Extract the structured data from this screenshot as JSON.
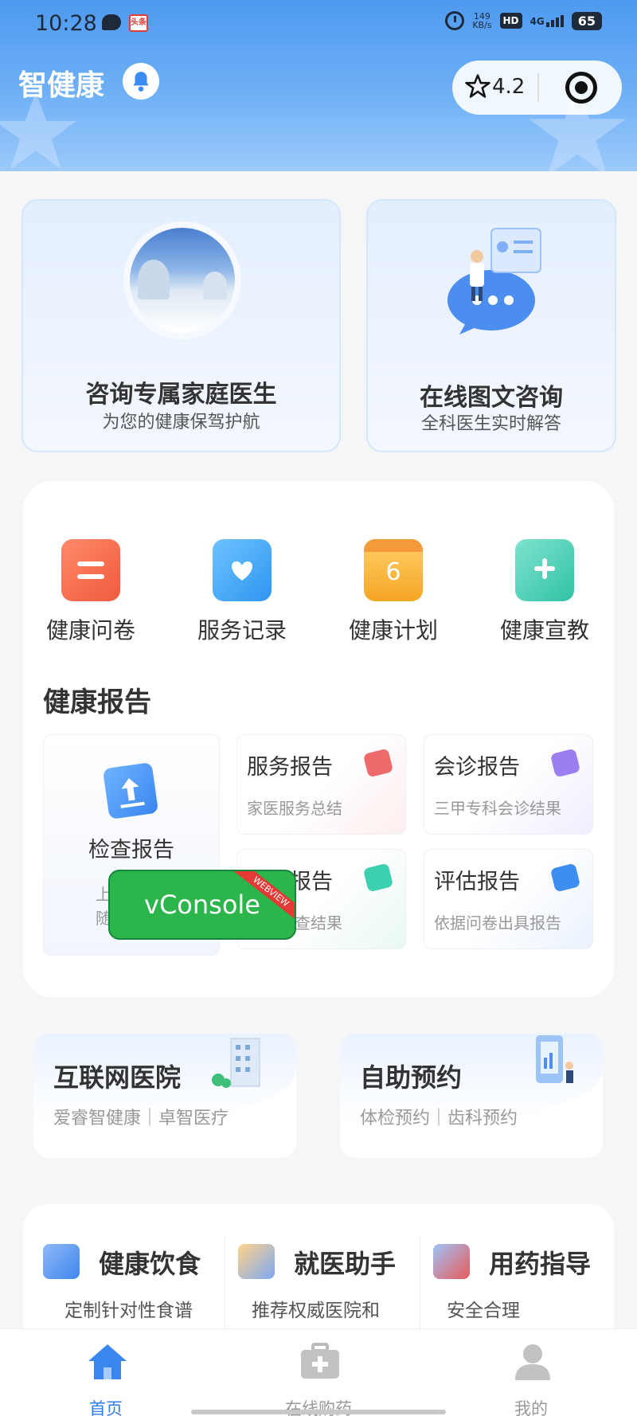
{
  "status_bar": {
    "time": "10:28",
    "news_badge": "头条",
    "net_speed_value": "149",
    "net_speed_unit": "KB/s",
    "hd": "HD",
    "network": "4G",
    "battery": "65"
  },
  "header": {
    "app_title": "智健康",
    "rating": "4.2"
  },
  "consult_cards": [
    {
      "title": "咨询专属家庭医生",
      "subtitle": "为您的健康保驾护航"
    },
    {
      "title": "在线图文咨询",
      "subtitle": "全科医生实时解答"
    }
  ],
  "services": [
    {
      "label": "健康问卷",
      "icon": "questionnaire-icon",
      "color": "#f0684a"
    },
    {
      "label": "服务记录",
      "icon": "record-icon",
      "color": "#3ca7f5"
    },
    {
      "label": "健康计划",
      "icon": "calendar-icon",
      "color": "#f7b73e"
    },
    {
      "label": "健康宣教",
      "icon": "education-icon",
      "color": "#3fcfb4"
    }
  ],
  "health_report": {
    "title": "健康报告",
    "main": {
      "title": "检查报告",
      "subtitle_line1": "上",
      "subtitle_line2": "随"
    },
    "items": [
      {
        "title": "服务报告",
        "subtitle": "家医服务总结",
        "color": "#ef6a6a"
      },
      {
        "title": "会诊报告",
        "subtitle": "三甲专科会诊结果",
        "color": "#9b7ef0"
      },
      {
        "title": "解读报告",
        "subtitle": "医疗检查结果",
        "color": "#3ccfb0"
      },
      {
        "title": "评估报告",
        "subtitle": "依据问卷出具报告",
        "color": "#3c8ff0"
      }
    ]
  },
  "vconsole": {
    "label": "vConsole",
    "ribbon": "WEBVIEW"
  },
  "hospital_cards": [
    {
      "title": "互联网医院",
      "subtitle": "爱睿智健康｜卓智医疗"
    },
    {
      "title": "自助预约",
      "subtitle": "体检预约｜齿科预约"
    }
  ],
  "features": [
    {
      "title": "健康饮食",
      "subtitle": "定制针对性食谱"
    },
    {
      "title": "就医助手",
      "subtitle": "推荐权威医院和"
    },
    {
      "title": "用药指导",
      "subtitle": "安全合理"
    }
  ],
  "tabbar": [
    {
      "label": "首页",
      "active": true
    },
    {
      "label": "在线购药",
      "active": false
    },
    {
      "label": "我的",
      "active": false
    }
  ]
}
